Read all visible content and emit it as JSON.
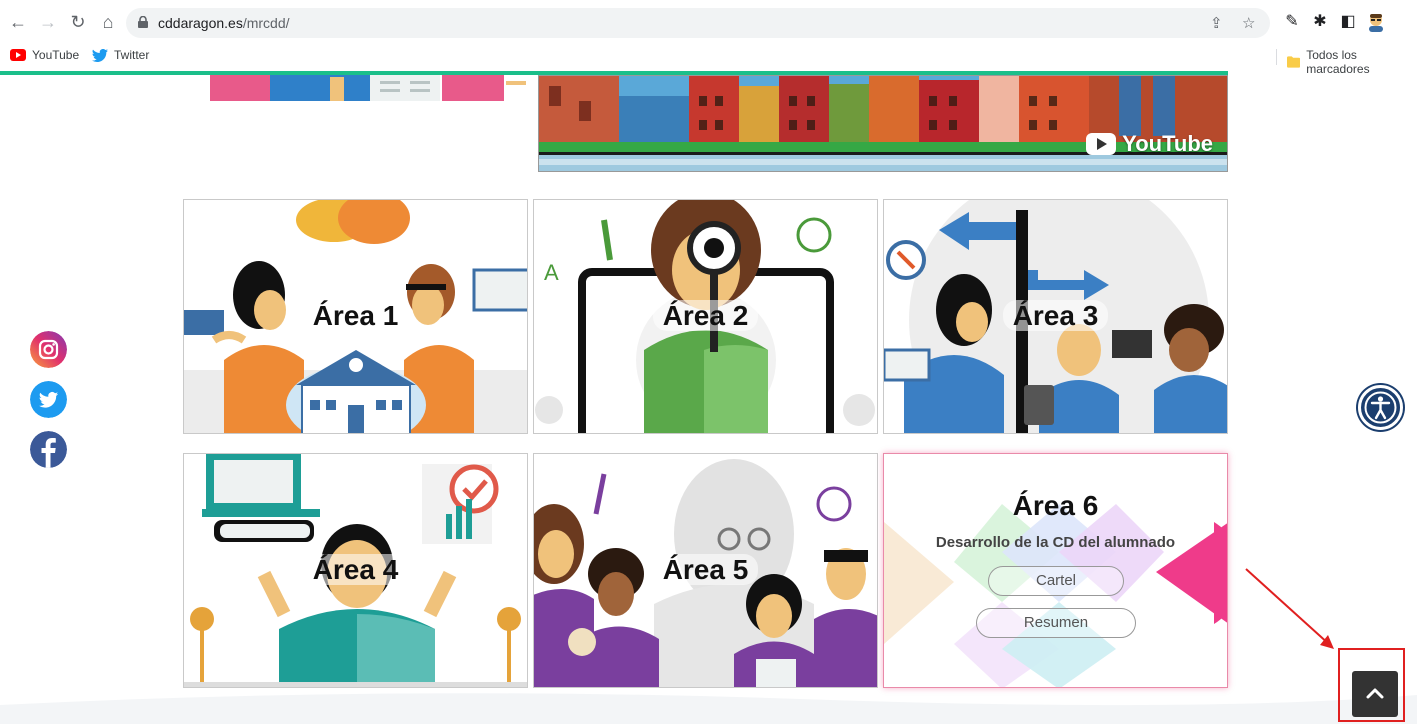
{
  "browser": {
    "url_domain": "cddaragon.es",
    "url_path": "/mrcdd/",
    "bookmarks": [
      {
        "label": "YouTube"
      },
      {
        "label": "Twitter"
      }
    ],
    "bookmarks_folder": "Todos los marcadores"
  },
  "page": {
    "banner_badge": "YouTube",
    "areas": [
      {
        "title": "Área 1"
      },
      {
        "title": "Área 2"
      },
      {
        "title": "Área 3"
      },
      {
        "title": "Área 4"
      },
      {
        "title": "Área 5"
      }
    ],
    "area6": {
      "title": "Área 6",
      "subtitle": "Desarrollo de la CD del alumnado",
      "button_cartel": "Cartel",
      "button_resumen": "Resumen"
    }
  },
  "colors": {
    "progress_bar": "#1bbf8a",
    "accessibility": "#1b3e6e",
    "scroll_top": "#333333",
    "annotation": "#e02020"
  }
}
